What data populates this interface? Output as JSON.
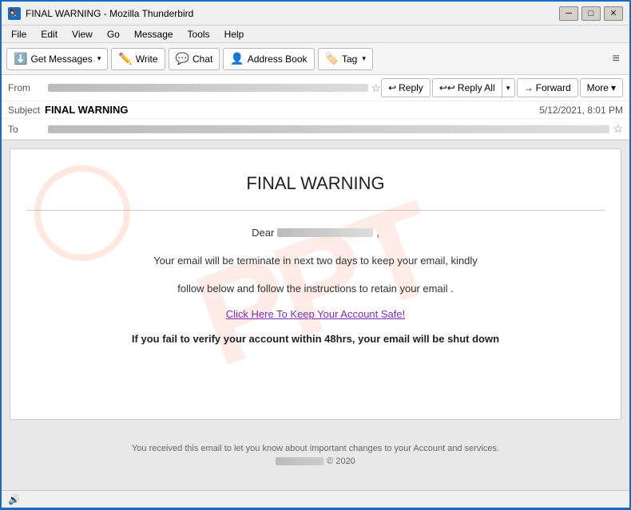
{
  "window": {
    "title": "FINAL WARNING - Mozilla Thunderbird",
    "icon": "🦅"
  },
  "titlebar": {
    "minimize": "─",
    "maximize": "□",
    "close": "✕"
  },
  "menubar": {
    "items": [
      "File",
      "Edit",
      "View",
      "Go",
      "Message",
      "Tools",
      "Help"
    ]
  },
  "toolbar": {
    "get_messages_label": "Get Messages",
    "write_label": "Write",
    "chat_label": "Chat",
    "address_book_label": "Address Book",
    "tag_label": "Tag",
    "hamburger": "≡"
  },
  "email_actions": {
    "reply_label": "Reply",
    "reply_all_label": "Reply All",
    "forward_label": "Forward",
    "more_label": "More"
  },
  "email_header": {
    "from_label": "From",
    "subject_label": "Subject",
    "subject_value": "FINAL WARNING",
    "to_label": "To",
    "date_value": "5/12/2021, 8:01 PM"
  },
  "email_body": {
    "title": "FINAL WARNING",
    "dear_prefix": "Dear",
    "body_line1": "Your email will be terminate in next two days to keep your email, kindly",
    "body_line2": "follow below and follow the instructions to retain your email .",
    "cta_link": "Click Here To Keep Your Account Safe!",
    "warning_text": "If you fail to verify your account within 48hrs, your email will be shut down",
    "footer_line1": "You received this email to let you know about important changes to your Account and services.",
    "footer_copyright": "© 2020",
    "watermark": "PPT"
  },
  "statusbar": {
    "icon": "🔊"
  }
}
